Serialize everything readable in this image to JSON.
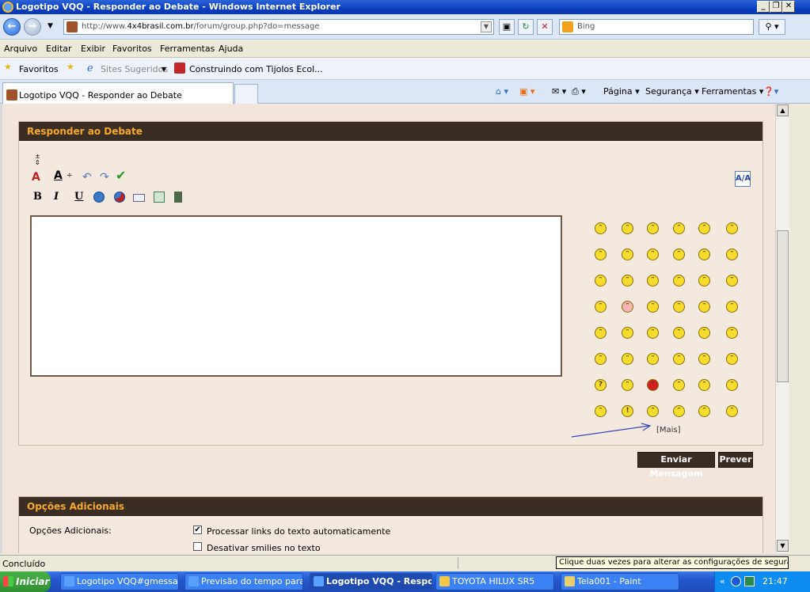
{
  "window": {
    "title": "Logotipo VQQ - Responder ao Debate - Windows Internet Explorer"
  },
  "address_bar": {
    "url_prefix": "http://www.",
    "url_domain": "4x4brasil.com.br",
    "url_path": "/forum/group.php?do=message",
    "search_placeholder": "Bing"
  },
  "menu": [
    "Arquivo",
    "Editar",
    "Exibir",
    "Favoritos",
    "Ferramentas",
    "Ajuda"
  ],
  "favorites_bar": {
    "favorites_label": "Favoritos",
    "suggested_label": "Sites Sugeridos",
    "youtube_item": "Construindo com Tijolos Ecol..."
  },
  "tab": {
    "title": "Logotipo VQQ - Responder ao Debate"
  },
  "command_bar": {
    "page": "Página",
    "security": "Segurança",
    "tools": "Ferramentas"
  },
  "reply_panel": {
    "header": "Responder ao Debate",
    "toolbar_bold": "B",
    "toolbar_italic": "I",
    "toolbar_underline": "U",
    "editor_value": "",
    "more_smilies": "[Mais]"
  },
  "buttons": {
    "send": "Enviar Mensagem",
    "preview": "Prever"
  },
  "options_panel": {
    "header": "Opções Adicionais",
    "label": "Opções Adicionais:",
    "option1": "Processar links do texto automaticamente",
    "option1_checked": true,
    "option2": "Desativar smilies no texto",
    "option2_checked": false
  },
  "status_bar": {
    "text": "Concluído",
    "tooltip": "Clique duas vezes para alterar as configurações de segurança"
  },
  "taskbar": {
    "start": "Iniciar",
    "tasks": [
      "Logotipo VQQ#gmessag...",
      "Previsão do tempo para ...",
      "Logotipo VQQ - Respo...",
      "TOYOTA HILUX SR5",
      "Tela001 - Paint"
    ],
    "clock": "21:47"
  },
  "colors": {
    "panel_header_bg": "#3a2d23",
    "panel_header_text": "#f7a92a",
    "content_bg": "#f2e6dc"
  }
}
